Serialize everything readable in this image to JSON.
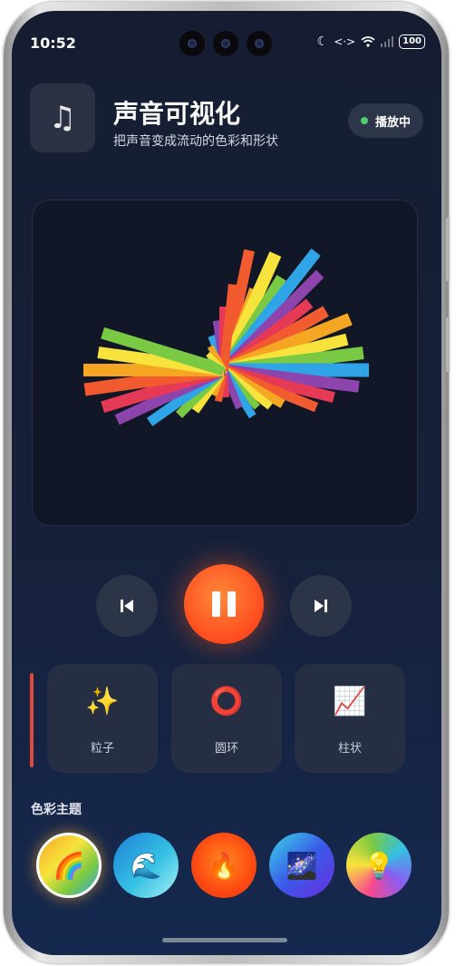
{
  "status_bar": {
    "time": "10:52",
    "battery": "100"
  },
  "header": {
    "app_icon": "music-note-icon",
    "title": "声音可视化",
    "subtitle": "把声音变成流动的色彩和形状",
    "status_label": "播放中",
    "status_color": "#4fd06a"
  },
  "visualizer": {
    "colors": [
      "#f25a2f",
      "#f5a623",
      "#f7e33c",
      "#7ac943",
      "#2fa4e7",
      "#8e44ad",
      "#e63956"
    ]
  },
  "transport": {
    "prev_icon": "skip-previous-icon",
    "pause_icon": "pause-icon",
    "next_icon": "skip-next-icon",
    "accent_color": "#ff5a1f"
  },
  "modes": [
    {
      "label": "粒子",
      "icon": "sparkles-icon",
      "glyph": "✨"
    },
    {
      "label": "圆环",
      "icon": "ring-icon",
      "glyph": "⭕"
    },
    {
      "label": "柱状",
      "icon": "chart-trend-icon",
      "glyph": "📈"
    }
  ],
  "themes": {
    "heading": "色彩主题",
    "items": [
      {
        "icon": "rainbow-icon",
        "glyph": "🌈",
        "selected": true
      },
      {
        "icon": "wave-icon",
        "glyph": "🌊",
        "selected": false
      },
      {
        "icon": "fire-icon",
        "glyph": "🔥",
        "selected": false
      },
      {
        "icon": "night-sky-icon",
        "glyph": "🌌",
        "selected": false
      },
      {
        "icon": "light-bulb-icon",
        "glyph": "💡",
        "selected": false
      }
    ]
  }
}
